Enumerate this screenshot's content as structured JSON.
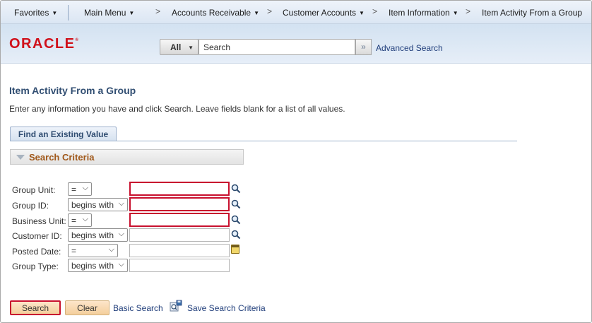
{
  "menubar": {
    "favorites": "Favorites",
    "main_menu": "Main Menu",
    "accounts_receivable": "Accounts Receivable",
    "customer_accounts": "Customer Accounts",
    "item_information": "Item Information",
    "current": "Item Activity From a Group",
    "separator": ">"
  },
  "header": {
    "logo": "ORACLE",
    "search_scope": "All",
    "search_value": "Search",
    "go_icon": "double-chevron-right",
    "advanced_search": "Advanced Search"
  },
  "page": {
    "title": "Item Activity From a Group",
    "instructions": "Enter any information you have and click Search. Leave fields blank for a list of all values.",
    "tab": "Find an Existing Value",
    "section": "Search Criteria"
  },
  "criteria": [
    {
      "label": "Group Unit:",
      "operator": "=",
      "value": "",
      "required": true,
      "icon": "magnifier-icon"
    },
    {
      "label": "Group ID:",
      "operator": "begins with",
      "value": "",
      "required": true,
      "icon": "magnifier-icon"
    },
    {
      "label": "Business Unit:",
      "operator": "=",
      "value": "",
      "required": true,
      "icon": "magnifier-icon"
    },
    {
      "label": "Customer ID:",
      "operator": "begins with",
      "value": "",
      "required": false,
      "icon": "magnifier-icon"
    },
    {
      "label": "Posted Date:",
      "operator": "=",
      "value": "",
      "required": false,
      "icon": "calendar-icon"
    },
    {
      "label": "Group Type:",
      "operator": "begins with",
      "value": "",
      "required": false,
      "icon": ""
    }
  ],
  "actions": {
    "search": "Search",
    "clear": "Clear",
    "basic_search": "Basic Search",
    "save_search": "Save Search Criteria"
  },
  "colors": {
    "accent_red": "#c8102e",
    "title_blue": "#314e72",
    "section_orange": "#a0581a"
  }
}
